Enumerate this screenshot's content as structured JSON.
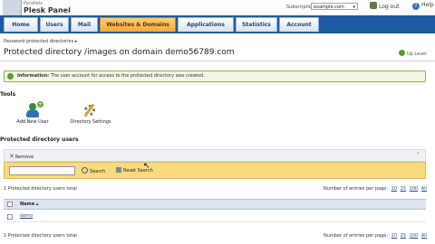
{
  "header": {
    "brand_small": "Parallels",
    "brand": "Plesk Panel",
    "subscription_label": "Subscription:",
    "subscription_value": "example.com",
    "logout": "Log out",
    "help": "Help"
  },
  "tabs": [
    "Home",
    "Users",
    "Mail",
    "Websites & Domains",
    "Applications",
    "Statistics",
    "Account"
  ],
  "active_tab": 3,
  "breadcrumb": "Password protected directories",
  "page_title": "Protected directory /images on domain demo56789.com",
  "up_level": "Up Level",
  "info": {
    "label": "Information:",
    "text": "The user account for access to the protected directory was created."
  },
  "tools": {
    "heading": "Tools",
    "add_user": "Add New User",
    "settings": "Directory Settings"
  },
  "users": {
    "heading": "Protected directory users",
    "remove": "Remove",
    "search_button": "Search",
    "reset_button": "Reset Search",
    "search_placeholder": "",
    "total": "1 Protected directory users total",
    "per_page_label": "Number of entries per page:",
    "per_page_options": [
      "10",
      "25",
      "100",
      "All"
    ],
    "column_name": "Name",
    "rows": [
      {
        "name": "demo"
      }
    ]
  },
  "colors": {
    "nav_blue": "#1e5aa2",
    "active_tab": "#f4a73a",
    "search_bar": "#fbd97d",
    "info_green": "#8db055"
  },
  "icons": [
    "logout-icon",
    "help-icon",
    "up-level-icon",
    "info-icon",
    "add-user-icon",
    "directory-settings-icon",
    "remove-icon",
    "search-icon",
    "reset-icon",
    "collapse-icon"
  ]
}
